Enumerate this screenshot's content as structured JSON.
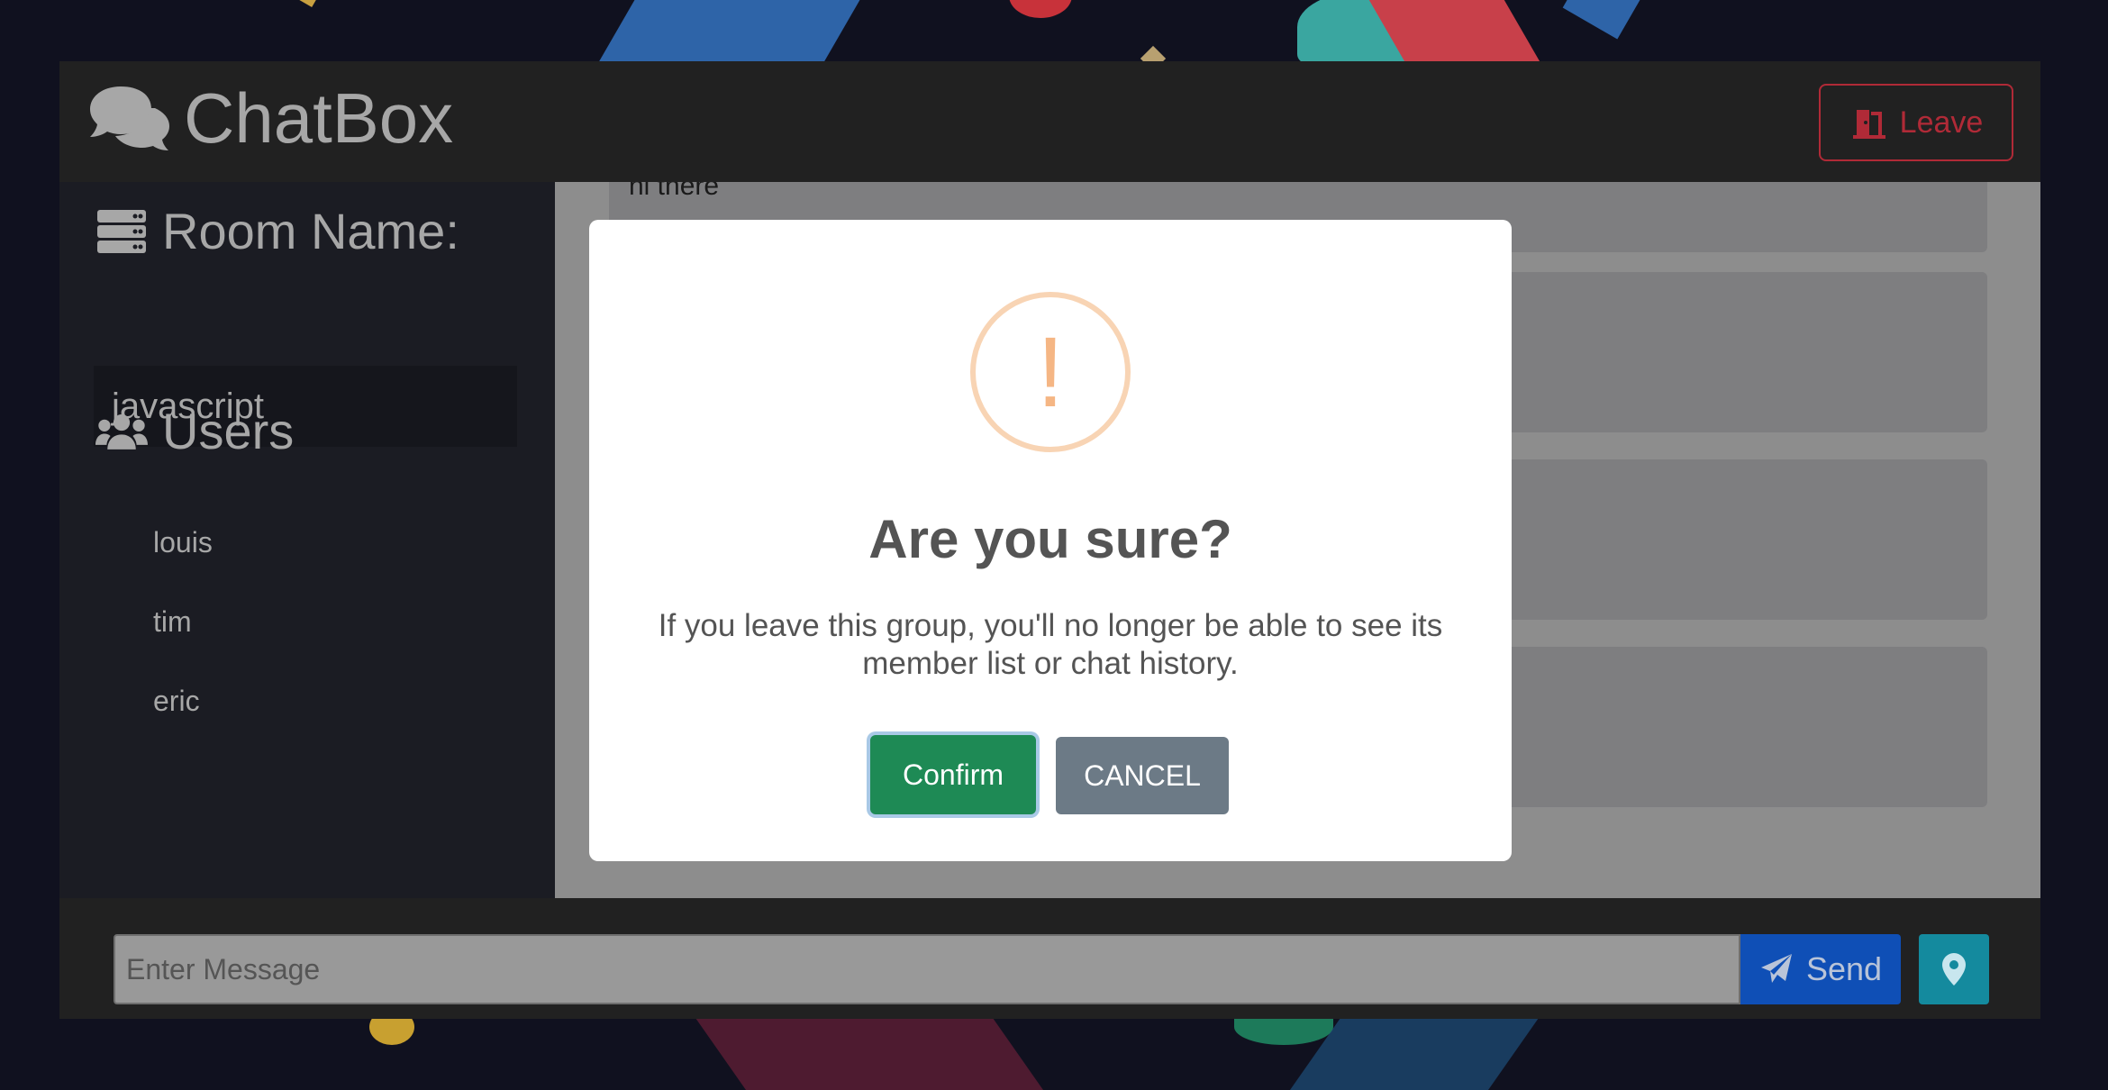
{
  "app": {
    "title": "ChatBox",
    "leave_label": "Leave"
  },
  "sidebar": {
    "room_heading": "Room Name:",
    "room_name": "javascript",
    "users_heading": "Users",
    "users": [
      "louis",
      "tim",
      "eric"
    ]
  },
  "chat": {
    "messages": [
      "hi there",
      "",
      "",
      ""
    ]
  },
  "footer": {
    "input_placeholder": "Enter Message",
    "send_label": "Send"
  },
  "modal": {
    "icon_glyph": "!",
    "title": "Are you sure?",
    "text": "If you leave this group, you'll no longer be able to see its member list or chat history.",
    "confirm_label": "Confirm",
    "cancel_label": "CANCEL"
  },
  "icons": {
    "brand": "comments-icon",
    "leave": "door-open-icon",
    "room": "server-icon",
    "users": "users-icon",
    "send": "paper-plane-icon",
    "location": "map-marker-icon",
    "warning": "exclamation-circle-icon"
  },
  "colors": {
    "danger": "#b02a37",
    "confirm": "#1e8a55",
    "cancel": "#6c7a86",
    "send": "#0f4fb6",
    "location": "#148a9e",
    "warning": "#f5b684"
  }
}
